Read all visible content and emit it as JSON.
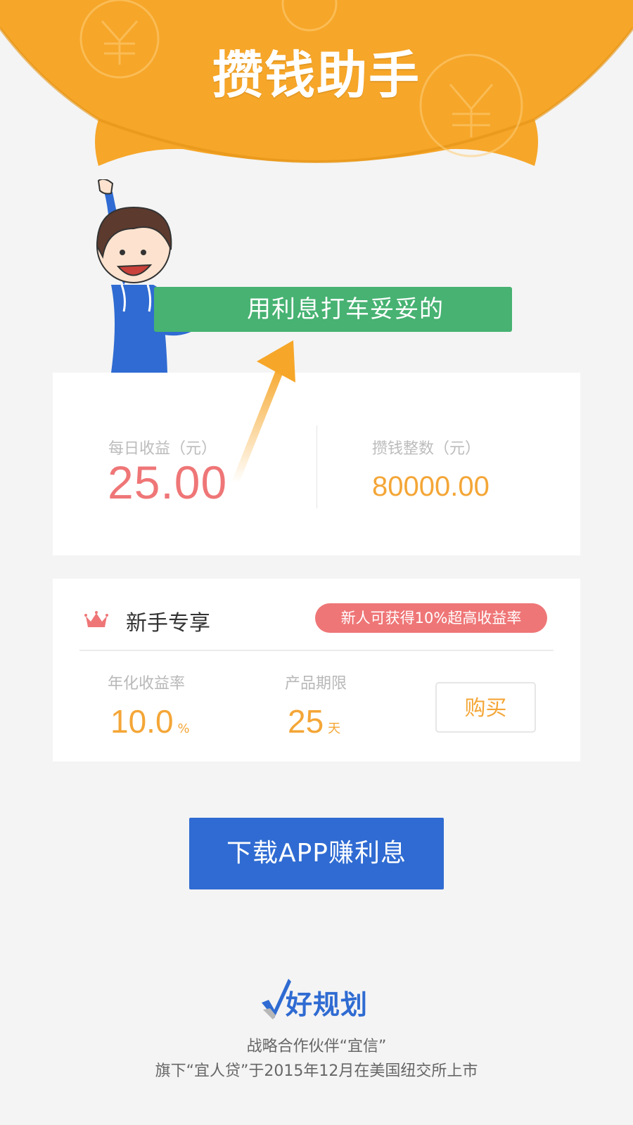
{
  "header": {
    "title": "攒钱助手"
  },
  "slogan": "用利息打车妥妥的",
  "earnings": {
    "daily_label": "每日收益（元）",
    "daily_value": "25.00",
    "total_label": "攒钱整数（元）",
    "total_value": "80000.00"
  },
  "newbie": {
    "title": "新手专享",
    "promo": "新人可获得10%超高收益率",
    "rate_label": "年化收益率",
    "rate_value": "10.0",
    "rate_unit": "%",
    "term_label": "产品期限",
    "term_value": "25",
    "term_unit": "天",
    "buy_label": "购买"
  },
  "download_label": "下载APP赚利息",
  "brand_name": "好规划",
  "footer": {
    "line1": "战略合作伙伴“宜信”",
    "line2": "旗下“宜人贷”于2015年12月在美国纽交所上市"
  },
  "colors": {
    "hero_orange": "#f6a629",
    "slogan_green": "#47b272",
    "daily_red": "#ef7677",
    "accent_orange": "#f4a637",
    "button_blue": "#2f6bd2"
  },
  "icons": [
    "coin-pattern-icon",
    "crown-icon",
    "arrow-up-icon",
    "checkmark-icon"
  ]
}
